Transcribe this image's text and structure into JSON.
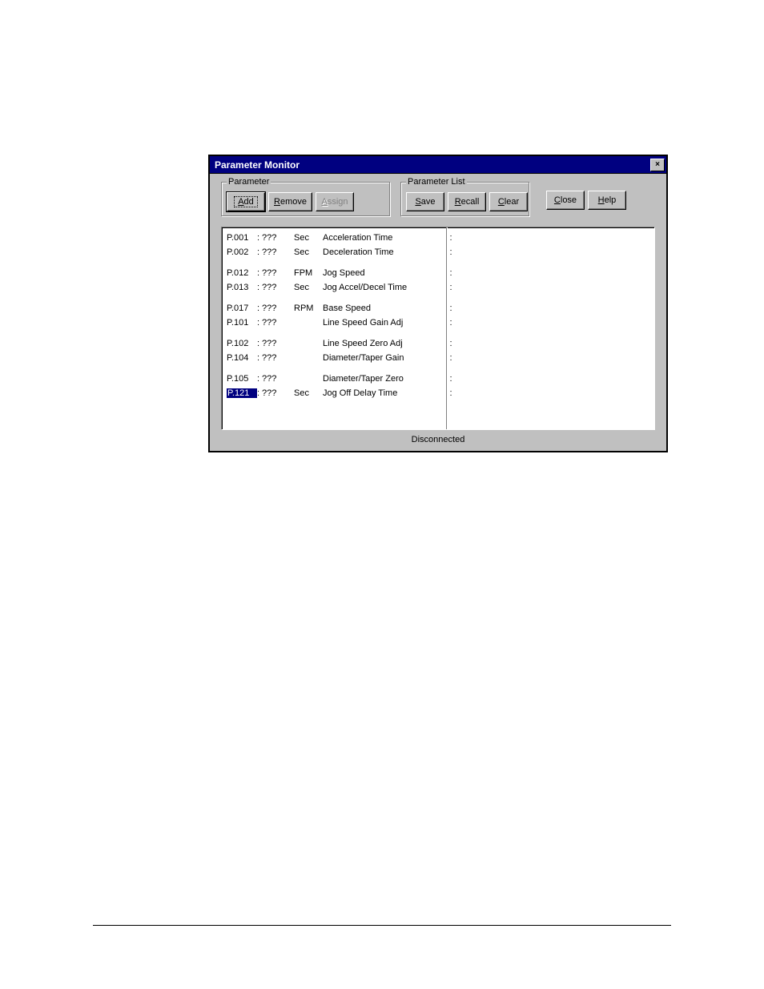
{
  "dialog": {
    "title": "Parameter Monitor",
    "close_x": "×",
    "groups": {
      "parameter_legend": "Parameter",
      "parameter_list_legend": "Parameter List"
    },
    "buttons": {
      "add_u": "A",
      "add_rest": "dd",
      "remove_u": "R",
      "remove_rest": "emove",
      "assign_u": "A",
      "assign_rest": "ssign",
      "save_u": "S",
      "save_rest": "ave",
      "recall_u": "R",
      "recall_rest": "ecall",
      "clear_u": "C",
      "clear_rest": "lear",
      "close_u": "C",
      "close_rest": "lose",
      "help_u": "H",
      "help_rest": "elp"
    },
    "status": "Disconnected"
  },
  "rows": [
    {
      "id": "P.001",
      "val": "???",
      "unit": "Sec",
      "desc": "Acceleration Time",
      "gap": false,
      "sel": false
    },
    {
      "id": "P.002",
      "val": "???",
      "unit": "Sec",
      "desc": "Deceleration Time",
      "gap": false,
      "sel": false
    },
    {
      "id": "P.012",
      "val": "???",
      "unit": "FPM",
      "desc": "Jog Speed",
      "gap": true,
      "sel": false
    },
    {
      "id": "P.013",
      "val": "???",
      "unit": "Sec",
      "desc": "Jog Accel/Decel Time",
      "gap": false,
      "sel": false
    },
    {
      "id": "P.017",
      "val": "???",
      "unit": "RPM",
      "desc": "Base Speed",
      "gap": true,
      "sel": false
    },
    {
      "id": "P.101",
      "val": "???",
      "unit": "",
      "desc": "Line Speed Gain Adj",
      "gap": false,
      "sel": false
    },
    {
      "id": "P.102",
      "val": "???",
      "unit": "",
      "desc": "Line Speed Zero Adj",
      "gap": true,
      "sel": false
    },
    {
      "id": "P.104",
      "val": "???",
      "unit": "",
      "desc": "Diameter/Taper Gain",
      "gap": false,
      "sel": false
    },
    {
      "id": "P.105",
      "val": "???",
      "unit": "",
      "desc": "Diameter/Taper Zero",
      "gap": true,
      "sel": false
    },
    {
      "id": "P.121",
      "val": "???",
      "unit": "Sec",
      "desc": "Jog Off Delay Time",
      "gap": false,
      "sel": true
    }
  ]
}
